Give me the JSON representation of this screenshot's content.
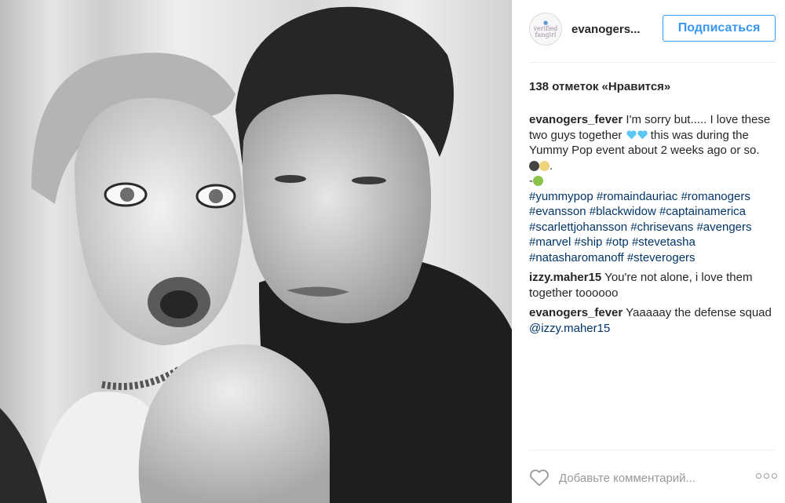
{
  "post": {
    "username": "evanogers...",
    "avatar_text_line1": "verified",
    "avatar_text_line2": "fangirl",
    "follow_label": "Подписаться",
    "likes_text": "138 отметок «Нравится»"
  },
  "caption": {
    "user": "evanogers_fever",
    "text_part1": "I'm sorry but..... I love these two guys together",
    "text_part2": "this was during the Yummy Pop event about 2 weeks ago or so.",
    "text_part3": ".",
    "text_part4": "-",
    "hashtags": [
      "#yummypop",
      "#romaindauriac",
      "#romanogers",
      "#evansson",
      "#blackwidow",
      "#captainamerica",
      "#scarlettjohansson",
      "#chrisevans",
      "#avengers",
      "#marvel",
      "#ship",
      "#otp",
      "#stevetasha",
      "#natasharomanoff",
      "#steverogers"
    ]
  },
  "comments": [
    {
      "user": "izzy.maher15",
      "text": "You're not alone, i love them together toooooo"
    },
    {
      "user": "evanogers_fever",
      "text": "Yaaaaay the defense squad",
      "mention": "@izzy.maher15"
    }
  ],
  "footer": {
    "add_comment_placeholder": "Добавьте комментарий..."
  },
  "colors": {
    "accent": "#3897f0",
    "hashtag": "#003569",
    "heart_emoji": "#5bc8f5"
  },
  "icons": {
    "like": "heart-outline-icon",
    "more": "more-options-icon"
  }
}
